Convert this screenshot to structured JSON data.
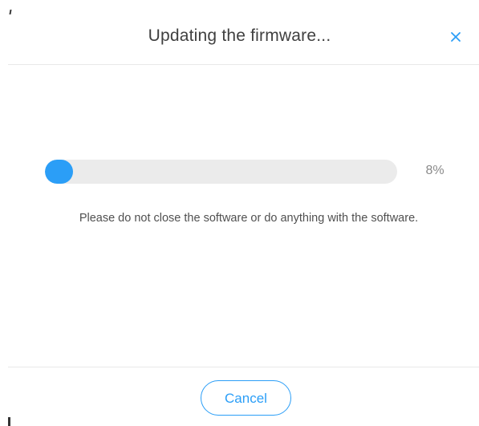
{
  "dialog": {
    "title": "Updating the firmware...",
    "close_icon": "close-icon"
  },
  "progress": {
    "value_percent": 8,
    "label": "8%",
    "fill_color": "#2b9ef7",
    "track_color": "#ebebeb"
  },
  "message": "Please do not close the software or do anything with the software.",
  "footer": {
    "cancel_label": "Cancel"
  },
  "colors": {
    "accent": "#2b9ef7",
    "title_text": "#404040",
    "body_text": "#505050"
  }
}
